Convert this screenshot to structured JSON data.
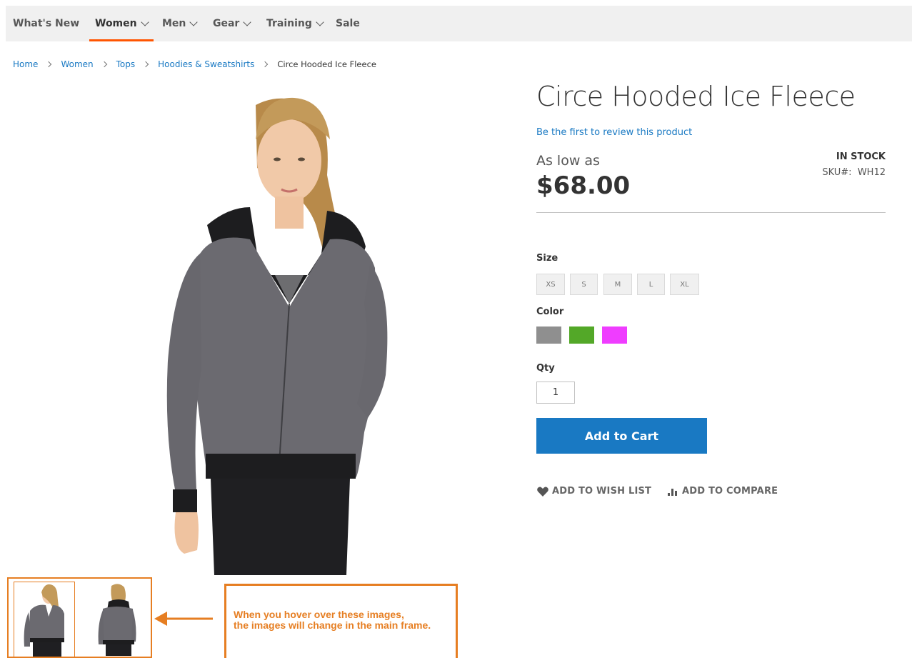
{
  "nav": {
    "items": [
      {
        "label": "What's New",
        "dropdown": false
      },
      {
        "label": "Women",
        "dropdown": true,
        "active": true
      },
      {
        "label": "Men",
        "dropdown": true
      },
      {
        "label": "Gear",
        "dropdown": true
      },
      {
        "label": "Training",
        "dropdown": true
      },
      {
        "label": "Sale",
        "dropdown": false
      }
    ]
  },
  "breadcrumb": {
    "links": [
      "Home",
      "Women",
      "Tops",
      "Hoodies & Sweatshirts"
    ],
    "current": "Circe Hooded Ice Fleece"
  },
  "product": {
    "title": "Circe Hooded Ice Fleece",
    "review_link": "Be the first to review this product",
    "price_label": "As low as",
    "price": "$68.00",
    "stock": "IN STOCK",
    "sku_label": "SKU#:",
    "sku": "WH12"
  },
  "options": {
    "size_label": "Size",
    "sizes": [
      "XS",
      "S",
      "M",
      "L",
      "XL"
    ],
    "color_label": "Color",
    "colors": [
      {
        "name": "Gray",
        "hex": "#8f8f8f"
      },
      {
        "name": "Green",
        "hex": "#53a828"
      },
      {
        "name": "Purple",
        "hex": "#ef3dff"
      }
    ],
    "qty_label": "Qty",
    "qty_value": "1"
  },
  "actions": {
    "add_to_cart": "Add to Cart",
    "wishlist": "ADD TO WISH LIST",
    "compare": "ADD TO COMPARE"
  },
  "annotation": {
    "text": "When you hover over these images,\nthe images will change in the main frame."
  },
  "colors": {
    "accent": "#ff5501",
    "link": "#1979c3",
    "annotation": "#e67e22",
    "hoodie": "#6b6a70",
    "hoodie_trim": "#1d1d1f"
  }
}
